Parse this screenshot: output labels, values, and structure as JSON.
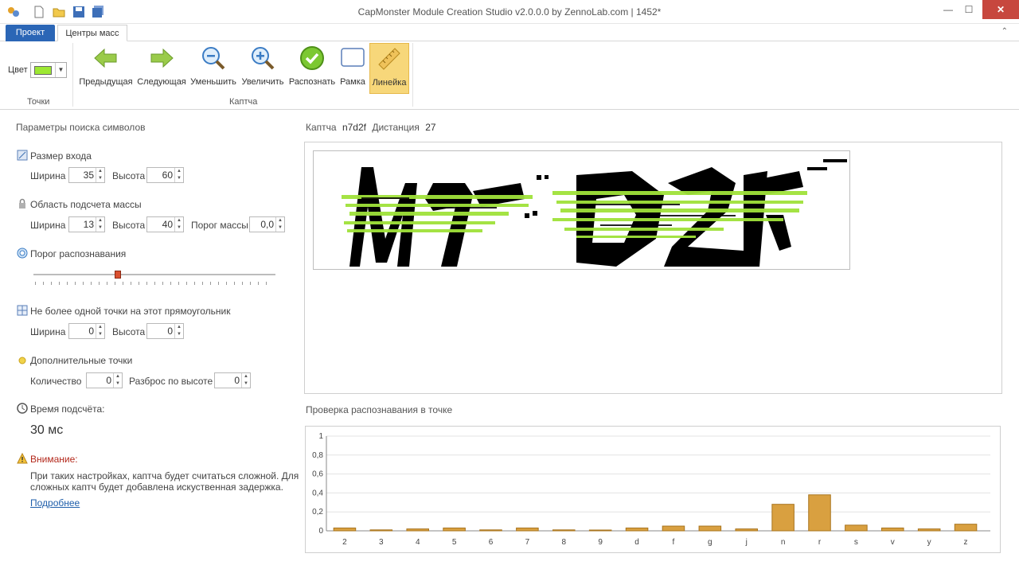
{
  "window": {
    "title": "CapMonster Module Creation Studio v2.0.0.0 by ZennoLab.com | 1452*"
  },
  "tabs": {
    "file": "Проект",
    "active": "Центры масс"
  },
  "ribbon": {
    "color_label": "Цвет",
    "color_value": "#9de833",
    "group_points": "Точки",
    "group_captcha": "Каптча",
    "buttons": [
      {
        "label": "Предыдущая",
        "icon": "arrow-left-icon"
      },
      {
        "label": "Следующая",
        "icon": "arrow-right-icon"
      },
      {
        "label": "Уменьшить",
        "icon": "zoom-out-icon"
      },
      {
        "label": "Увеличить",
        "icon": "zoom-in-icon"
      },
      {
        "label": "Распознать",
        "icon": "check-icon"
      },
      {
        "label": "Рамка",
        "icon": "frame-icon"
      },
      {
        "label": "Линейка",
        "icon": "ruler-icon",
        "active": true
      }
    ]
  },
  "params": {
    "title": "Параметры поиска символов",
    "input_size": {
      "title": "Размер входа",
      "width_label": "Ширина",
      "width": "35",
      "height_label": "Высота",
      "height": "60"
    },
    "mass_area": {
      "title": "Область подсчета массы",
      "width_label": "Ширина",
      "width": "13",
      "height_label": "Высота",
      "height": "40",
      "threshold_label": "Порог массы",
      "threshold": "0,0"
    },
    "recog_threshold": {
      "title": "Порог распознавания",
      "level": 0.35
    },
    "one_point": {
      "title": "Не более одной точки на этот прямоугольник",
      "width_label": "Ширина",
      "width": "0",
      "height_label": "Высота",
      "height": "0"
    },
    "extra_points": {
      "title": "Дополнительные точки",
      "count_label": "Количество",
      "count": "0",
      "spread_label": "Разброс по высоте",
      "spread": "0"
    },
    "time": {
      "title": "Время подсчёта:",
      "value": "30 мс"
    },
    "warning": {
      "title": "Внимание:",
      "text": "При таких настройках, каптча будет считаться сложной. Для сложных каптч будет добавлена искуственная задержка.",
      "link": "Подробнее"
    }
  },
  "captcha": {
    "label": "Каптча",
    "value": "n7d2f",
    "distance_label": "Дистанция",
    "distance": "27"
  },
  "check": {
    "title": "Проверка распознавания в точке"
  },
  "chart_data": {
    "type": "bar",
    "categories": [
      "2",
      "3",
      "4",
      "5",
      "6",
      "7",
      "8",
      "9",
      "d",
      "f",
      "g",
      "j",
      "n",
      "r",
      "s",
      "v",
      "y",
      "z"
    ],
    "values": [
      0.03,
      0.01,
      0.02,
      0.03,
      0.01,
      0.03,
      0.01,
      0.0,
      0.03,
      0.05,
      0.05,
      0.02,
      0.28,
      0.38,
      0.06,
      0.03,
      0.02,
      0.07
    ],
    "y_ticks": [
      "1",
      "0,8",
      "0,6",
      "0,4",
      "0,2",
      "0"
    ],
    "ylim": [
      0,
      1
    ],
    "grid": true,
    "bar_color": "#d9a040"
  }
}
